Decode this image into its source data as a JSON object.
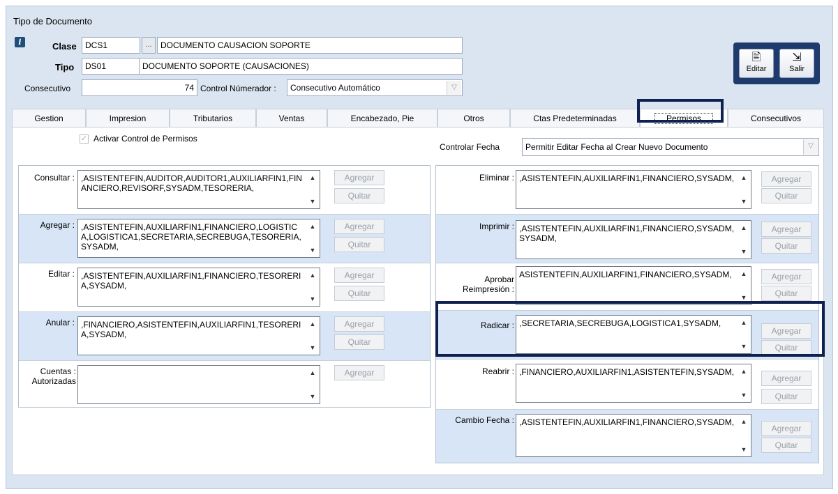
{
  "window": {
    "title": "Tipo de Documento"
  },
  "header": {
    "clase_label": "Clase",
    "clase_code": "DCS1",
    "clase_ellipsis": "...",
    "clase_desc": "DOCUMENTO CAUSACION SOPORTE",
    "tipo_label": "Tipo",
    "tipo_code": "DS01",
    "tipo_desc": "DOCUMENTO SOPORTE (CAUSACIONES)",
    "consecutivo_label": "Consecutivo",
    "consecutivo_value": "74",
    "control_label": "Control Númerador :",
    "control_value": "Consecutivo Automático"
  },
  "toolbar": {
    "edit_label": "Editar",
    "exit_label": "Salir"
  },
  "tabs": [
    {
      "label": "Gestion"
    },
    {
      "label": "Impresion"
    },
    {
      "label": "Tributarios"
    },
    {
      "label": "Ventas"
    },
    {
      "label": "Encabezado, Pie"
    },
    {
      "label": "Otros"
    },
    {
      "label": "Ctas Predeterminadas"
    },
    {
      "label": "Permisos",
      "active": true
    },
    {
      "label": "Consecutivos"
    }
  ],
  "permisos": {
    "activar_label": "Activar Control de Permisos",
    "activar_checked": true,
    "controlar_fecha_label": "Controlar Fecha",
    "controlar_fecha_value": "Permitir Editar Fecha al Crear Nuevo Documento",
    "add_label": "Agregar",
    "remove_label": "Quitar",
    "left": [
      {
        "label": "Consultar :",
        "value": ",ASISTENTEFIN,AUDITOR,AUDITOR1,AUXILIARFIN1,FINANCIERO,REVISORF,SYSADM,TESORERIA,"
      },
      {
        "label": "Agregar :",
        "value": ",ASISTENTEFIN,AUXILIARFIN1,FINANCIERO,LOGISTICA,LOGISTICA1,SECRETARIA,SECREBUGA,TESORERIA,SYSADM,"
      },
      {
        "label": "Editar :",
        "value": ",ASISTENTEFIN,AUXILIARFIN1,FINANCIERO,TESORERIA,SYSADM,"
      },
      {
        "label": "Anular :",
        "value": ",FINANCIERO,ASISTENTEFIN,AUXILIARFIN1,TESORERIA,SYSADM,"
      },
      {
        "label": "Cuentas : Autorizadas",
        "value": ""
      }
    ],
    "right": [
      {
        "label": "Eliminar :",
        "value": ",ASISTENTEFIN,AUXILIARFIN1,FINANCIERO,SYSADM,"
      },
      {
        "label": "Imprimir :",
        "value": ",ASISTENTEFIN,AUXILIARFIN1,FINANCIERO,SYSADM,SYSADM,"
      },
      {
        "label": "Aprobar Reimpresión :",
        "value": "ASISTENTEFIN,AUXILIARFIN1,FINANCIERO,SYSADM,"
      },
      {
        "label": "Radicar :",
        "value": ",SECRETARIA,SECREBUGA,LOGISTICA1,SYSADM,"
      },
      {
        "label": "Reabrir :",
        "value": ",FINANCIERO,AUXILIARFIN1,ASISTENTEFIN,SYSADM,"
      },
      {
        "label": "Cambio Fecha :",
        "value": ",ASISTENTEFIN,AUXILIARFIN1,FINANCIERO,SYSADM,"
      }
    ]
  },
  "colors": {
    "highlight": "#0f2150",
    "row_alt": "#d7e5f7",
    "window_bg": "#dbe5f1"
  }
}
